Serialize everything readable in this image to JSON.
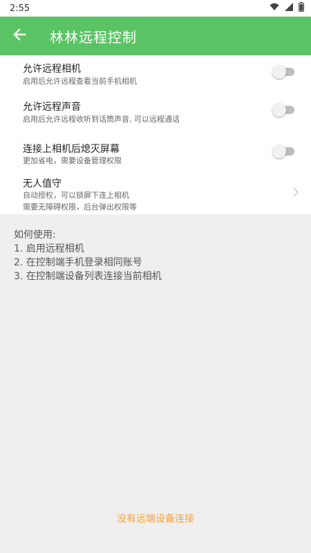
{
  "status_bar": {
    "time": "2:55",
    "icons": [
      "wifi-icon",
      "signal-icon",
      "battery-icon"
    ]
  },
  "app_bar": {
    "title": "林林远程控制",
    "back_icon": "arrow-left-icon",
    "background_color": "#5ac464"
  },
  "settings": {
    "items": [
      {
        "title": "允许远程相机",
        "subtitle": "启用后允许远程查看当前手机相机",
        "control": "toggle",
        "enabled": false
      },
      {
        "title": "允许远程声音",
        "subtitle": "启用后允许远程收听到话筒声音, 可以远程通话",
        "control": "toggle",
        "enabled": false
      },
      {
        "title": "连接上相机后熄灭屏幕",
        "subtitle": "更加省电，需要设备管理权限",
        "control": "toggle",
        "enabled": false
      },
      {
        "title": "无人值守",
        "subtitle": "自动授权，可以锁屏下连上相机",
        "subtitle2": "需要无障碍权限，后台弹出权限等",
        "control": "chevron"
      }
    ]
  },
  "howto": {
    "heading": "如何使用:",
    "steps": [
      "1. 启用远程相机",
      "2. 在控制端手机登录相同账号",
      "3. 在控制端设备列表连接当前相机"
    ]
  },
  "footer": {
    "status_text": "没有远端设备连接",
    "status_color": "#f4a23a"
  }
}
